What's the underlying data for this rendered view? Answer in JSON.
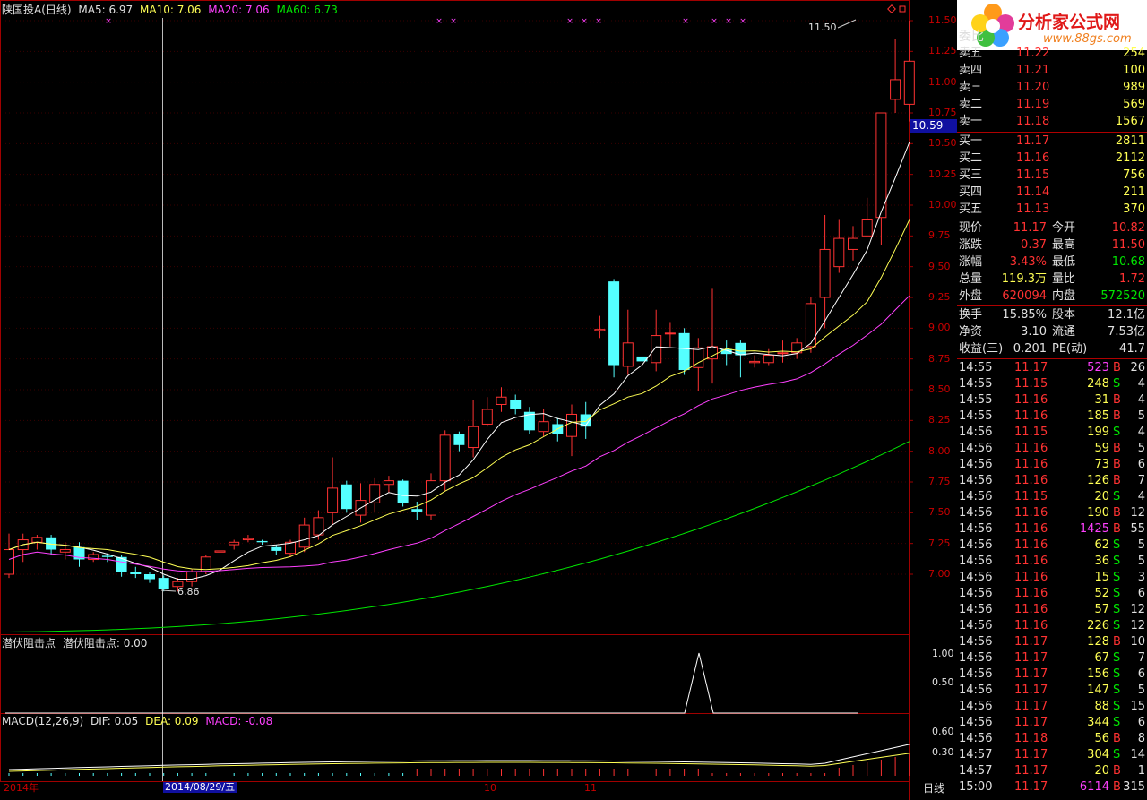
{
  "header": {
    "stock": "陕国投A",
    "period": "(日线)",
    "ma5": "MA5: 6.97",
    "ma10": "MA10: 7.06",
    "ma20": "MA20: 7.06",
    "ma60": "MA60: 6.73"
  },
  "price_axis": [
    "11.50",
    "11.25",
    "11.00",
    "10.75",
    "10.50",
    "10.25",
    "10.00",
    "9.75",
    "9.50",
    "9.25",
    "9.00",
    "8.75",
    "8.50",
    "8.25",
    "8.00",
    "7.75",
    "7.50",
    "7.25",
    "7.00"
  ],
  "crosshair_price": "10.59",
  "high_label": "11.50",
  "low_label": "6.86",
  "ind1": {
    "title": "潜伏阻击点",
    "value_label": "潜伏阻击点: 0.00",
    "axis": [
      "1.00",
      "0.50"
    ]
  },
  "macd": {
    "title": "MACD(12,26,9)",
    "dif": "DIF: 0.05",
    "dea": "DEA: 0.09",
    "macd": "MACD: -0.08",
    "axis": [
      "0.60",
      "0.30"
    ]
  },
  "date_axis": {
    "start": "2014年",
    "cursor": "2014/08/29/五",
    "m10": "10",
    "m11": "11",
    "period_btn": "日线"
  },
  "colors": {
    "up": "#ff3232",
    "down": "#54ffff",
    "ma5": "#ffffff",
    "ma10": "#ffff54",
    "ma20": "#ff40ff",
    "ma60": "#00e600"
  },
  "chart_data": {
    "type": "candlestick",
    "ylim": [
      6.8,
      11.6
    ],
    "candles": [
      [
        7.0,
        7.2,
        7.33,
        6.97
      ],
      [
        7.2,
        7.28,
        7.33,
        7.1
      ],
      [
        7.26,
        7.3,
        7.32,
        7.2
      ],
      [
        7.3,
        7.2,
        7.32,
        7.16
      ],
      [
        7.18,
        7.2,
        7.26,
        7.12
      ],
      [
        7.22,
        7.12,
        7.26,
        7.06
      ],
      [
        7.12,
        7.16,
        7.18,
        7.1
      ],
      [
        7.15,
        7.14,
        7.17,
        7.1
      ],
      [
        7.14,
        7.02,
        7.16,
        6.98
      ],
      [
        7.02,
        7.0,
        7.06,
        6.97
      ],
      [
        7.0,
        6.96,
        7.02,
        6.93
      ],
      [
        6.97,
        6.88,
        6.99,
        6.86
      ],
      [
        6.9,
        6.94,
        6.97,
        6.86
      ],
      [
        6.94,
        7.02,
        7.04,
        6.9
      ],
      [
        7.02,
        7.14,
        7.16,
        7.0
      ],
      [
        7.18,
        7.19,
        7.22,
        7.14
      ],
      [
        7.24,
        7.26,
        7.28,
        7.2
      ],
      [
        7.28,
        7.29,
        7.32,
        7.26
      ],
      [
        7.27,
        7.26,
        7.28,
        7.24
      ],
      [
        7.22,
        7.19,
        7.24,
        7.16
      ],
      [
        7.17,
        7.26,
        7.28,
        7.14
      ],
      [
        7.22,
        7.4,
        7.46,
        7.18
      ],
      [
        7.32,
        7.46,
        7.52,
        7.28
      ],
      [
        7.5,
        7.7,
        7.95,
        7.4
      ],
      [
        7.73,
        7.53,
        7.76,
        7.5
      ],
      [
        7.48,
        7.6,
        7.74,
        7.42
      ],
      [
        7.58,
        7.73,
        7.78,
        7.5
      ],
      [
        7.73,
        7.76,
        7.8,
        7.66
      ],
      [
        7.76,
        7.58,
        7.77,
        7.55
      ],
      [
        7.53,
        7.51,
        7.59,
        7.44
      ],
      [
        7.48,
        7.76,
        7.82,
        7.44
      ],
      [
        7.76,
        8.13,
        8.17,
        7.68
      ],
      [
        8.14,
        8.05,
        8.16,
        8.0
      ],
      [
        8.03,
        8.2,
        8.42,
        7.95
      ],
      [
        8.22,
        8.34,
        8.44,
        8.2
      ],
      [
        8.38,
        8.44,
        8.52,
        8.32
      ],
      [
        8.42,
        8.34,
        8.46,
        8.3
      ],
      [
        8.32,
        8.17,
        8.36,
        8.14
      ],
      [
        8.16,
        8.24,
        8.34,
        8.12
      ],
      [
        8.22,
        8.14,
        8.27,
        8.08
      ],
      [
        8.12,
        8.3,
        8.38,
        7.96
      ],
      [
        8.3,
        8.2,
        8.4,
        8.1
      ],
      [
        8.98,
        8.99,
        9.1,
        8.92
      ],
      [
        9.38,
        8.7,
        9.4,
        8.6
      ],
      [
        8.69,
        8.88,
        9.15,
        8.62
      ],
      [
        8.77,
        8.73,
        8.95,
        8.55
      ],
      [
        8.72,
        8.94,
        9.15,
        8.65
      ],
      [
        8.96,
        8.96,
        9.05,
        8.85
      ],
      [
        8.96,
        8.66,
        9.0,
        8.62
      ],
      [
        8.68,
        8.84,
        8.92,
        8.49
      ],
      [
        8.75,
        8.85,
        9.32,
        8.55
      ],
      [
        8.83,
        8.79,
        8.9,
        8.7
      ],
      [
        8.88,
        8.78,
        8.9,
        8.6
      ],
      [
        8.72,
        8.73,
        8.78,
        8.68
      ],
      [
        8.72,
        8.78,
        8.83,
        8.7
      ],
      [
        8.8,
        8.8,
        8.9,
        8.72
      ],
      [
        8.8,
        8.88,
        8.92,
        8.75
      ],
      [
        8.85,
        9.2,
        9.25,
        8.8
      ],
      [
        9.25,
        9.64,
        9.92,
        9.0
      ],
      [
        9.5,
        9.73,
        9.88,
        9.45
      ],
      [
        9.64,
        9.73,
        9.83,
        9.55
      ],
      [
        9.75,
        9.88,
        10.06,
        9.75
      ],
      [
        9.9,
        10.75,
        10.75,
        9.68
      ],
      [
        10.86,
        11.02,
        11.35,
        10.75
      ],
      [
        10.82,
        11.17,
        11.5,
        10.68
      ]
    ]
  },
  "orderbook": {
    "sell_head": "委比",
    "sell": [
      {
        "label": "卖五",
        "price": "11.22",
        "vol": "254"
      },
      {
        "label": "卖四",
        "price": "11.21",
        "vol": "100"
      },
      {
        "label": "卖三",
        "price": "11.20",
        "vol": "989"
      },
      {
        "label": "卖二",
        "price": "11.19",
        "vol": "569"
      },
      {
        "label": "卖一",
        "price": "11.18",
        "vol": "1567"
      }
    ],
    "buy": [
      {
        "label": "买一",
        "price": "11.17",
        "vol": "2811"
      },
      {
        "label": "买二",
        "price": "11.16",
        "vol": "2112"
      },
      {
        "label": "买三",
        "price": "11.15",
        "vol": "756"
      },
      {
        "label": "买四",
        "price": "11.14",
        "vol": "211"
      },
      {
        "label": "买五",
        "price": "11.13",
        "vol": "370"
      }
    ]
  },
  "stats": [
    {
      "l1": "现价",
      "v1": "11.17",
      "c1": "red",
      "l2": "今开",
      "v2": "10.82",
      "c2": "red"
    },
    {
      "l1": "涨跌",
      "v1": "0.37",
      "c1": "red",
      "l2": "最高",
      "v2": "11.50",
      "c2": "red"
    },
    {
      "l1": "涨幅",
      "v1": "3.43%",
      "c1": "red",
      "l2": "最低",
      "v2": "10.68",
      "c2": "grn"
    },
    {
      "l1": "总量",
      "v1": "119.3万",
      "c1": "yel",
      "l2": "量比",
      "v2": "1.72",
      "c2": "red"
    },
    {
      "l1": "外盘",
      "v1": "620094",
      "c1": "red",
      "l2": "内盘",
      "v2": "572520",
      "c2": "grn"
    }
  ],
  "stats2": [
    {
      "l1": "换手",
      "v1": "15.85%",
      "l2": "股本",
      "v2": "12.1亿"
    },
    {
      "l1": "净资",
      "v1": "3.10",
      "l2": "流通",
      "v2": "7.53亿"
    },
    {
      "l1": "收益(三)",
      "v1": "0.201",
      "l2": "PE(动)",
      "v2": "41.7"
    }
  ],
  "ticks": [
    [
      "14:55",
      "11.17",
      "523",
      "B",
      "26"
    ],
    [
      "14:55",
      "11.15",
      "248",
      "S",
      "4"
    ],
    [
      "14:55",
      "11.16",
      "31",
      "B",
      "4"
    ],
    [
      "14:55",
      "11.16",
      "185",
      "B",
      "5"
    ],
    [
      "14:56",
      "11.15",
      "199",
      "S",
      "4"
    ],
    [
      "14:56",
      "11.16",
      "59",
      "B",
      "5"
    ],
    [
      "14:56",
      "11.16",
      "73",
      "B",
      "6"
    ],
    [
      "14:56",
      "11.16",
      "126",
      "B",
      "7"
    ],
    [
      "14:56",
      "11.15",
      "20",
      "S",
      "4"
    ],
    [
      "14:56",
      "11.16",
      "190",
      "B",
      "12"
    ],
    [
      "14:56",
      "11.16",
      "1425",
      "B",
      "55"
    ],
    [
      "14:56",
      "11.16",
      "62",
      "S",
      "5"
    ],
    [
      "14:56",
      "11.16",
      "36",
      "S",
      "5"
    ],
    [
      "14:56",
      "11.16",
      "15",
      "S",
      "3"
    ],
    [
      "14:56",
      "11.16",
      "52",
      "S",
      "6"
    ],
    [
      "14:56",
      "11.16",
      "57",
      "S",
      "12"
    ],
    [
      "14:56",
      "11.16",
      "226",
      "S",
      "12"
    ],
    [
      "14:56",
      "11.17",
      "128",
      "B",
      "10"
    ],
    [
      "14:56",
      "11.17",
      "67",
      "S",
      "7"
    ],
    [
      "14:56",
      "11.17",
      "156",
      "S",
      "6"
    ],
    [
      "14:56",
      "11.17",
      "147",
      "S",
      "5"
    ],
    [
      "14:56",
      "11.17",
      "88",
      "S",
      "15"
    ],
    [
      "14:56",
      "11.17",
      "344",
      "S",
      "6"
    ],
    [
      "14:56",
      "11.18",
      "56",
      "B",
      "8"
    ],
    [
      "14:57",
      "11.17",
      "304",
      "S",
      "14"
    ],
    [
      "14:57",
      "11.17",
      "20",
      "B",
      "1"
    ],
    [
      "15:00",
      "11.17",
      "6114",
      "B",
      "315"
    ]
  ],
  "logo": {
    "text": "分析家公式网",
    "url": "www.88gs.com"
  }
}
